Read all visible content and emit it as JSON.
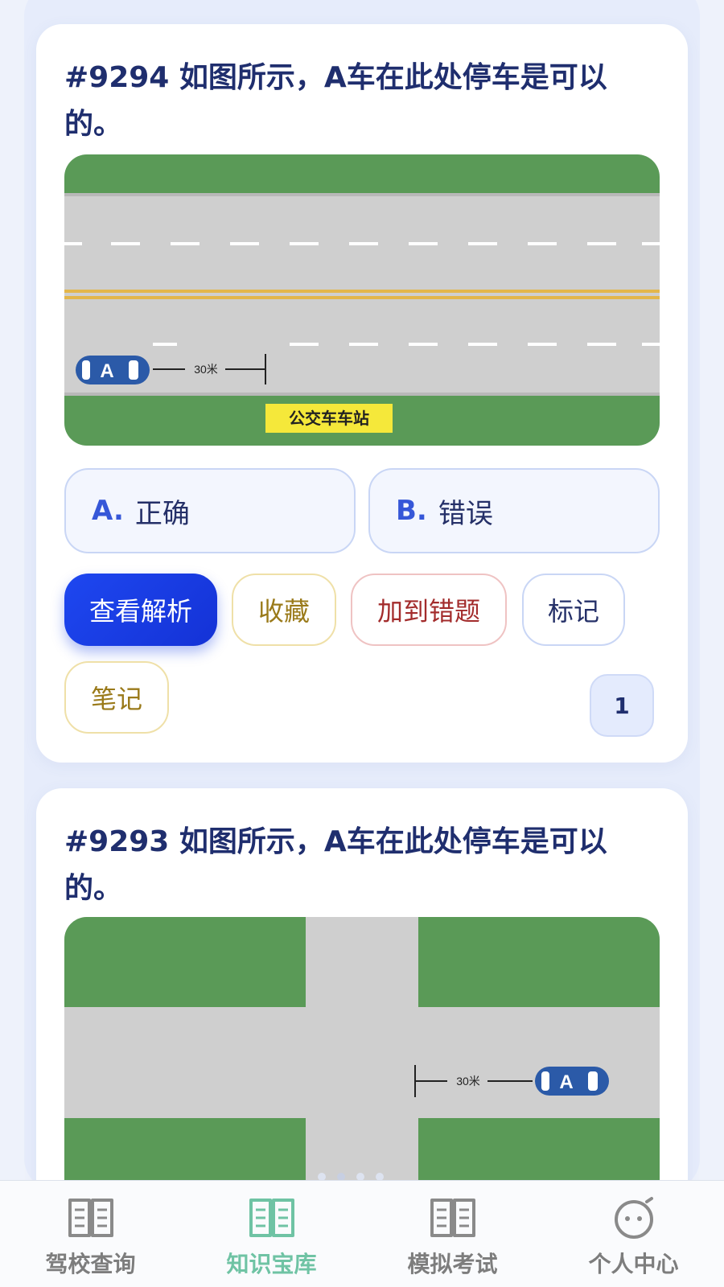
{
  "questions": [
    {
      "title": "#9294 如图所示，A车在此处停车是可以的。",
      "figure": {
        "car_label": "A",
        "distance_label": "30米",
        "sign_label": "公交车车站"
      },
      "options": [
        {
          "letter": "A.",
          "text": "正确"
        },
        {
          "letter": "B.",
          "text": "错误"
        }
      ],
      "actions": {
        "analysis": "查看解析",
        "favorite": "收藏",
        "add_wrong": "加到错题",
        "mark": "标记",
        "note": "笔记"
      },
      "page_number": "1"
    },
    {
      "title": "#9293 如图所示，A车在此处停车是可以的。",
      "figure": {
        "car_label": "A",
        "distance_label": "30米"
      }
    }
  ],
  "tabbar": {
    "items": [
      {
        "label": "驾校查询",
        "icon": "book-icon"
      },
      {
        "label": "知识宝库",
        "icon": "book-icon",
        "active": true
      },
      {
        "label": "模拟考试",
        "icon": "book-icon"
      },
      {
        "label": "个人中心",
        "icon": "face-icon"
      }
    ]
  },
  "colors": {
    "accent": "#1e47f0",
    "title": "#1f2e6e",
    "tab_active": "#6fc3a4",
    "grass": "#5a9a57",
    "road": "#cfcfcf"
  }
}
